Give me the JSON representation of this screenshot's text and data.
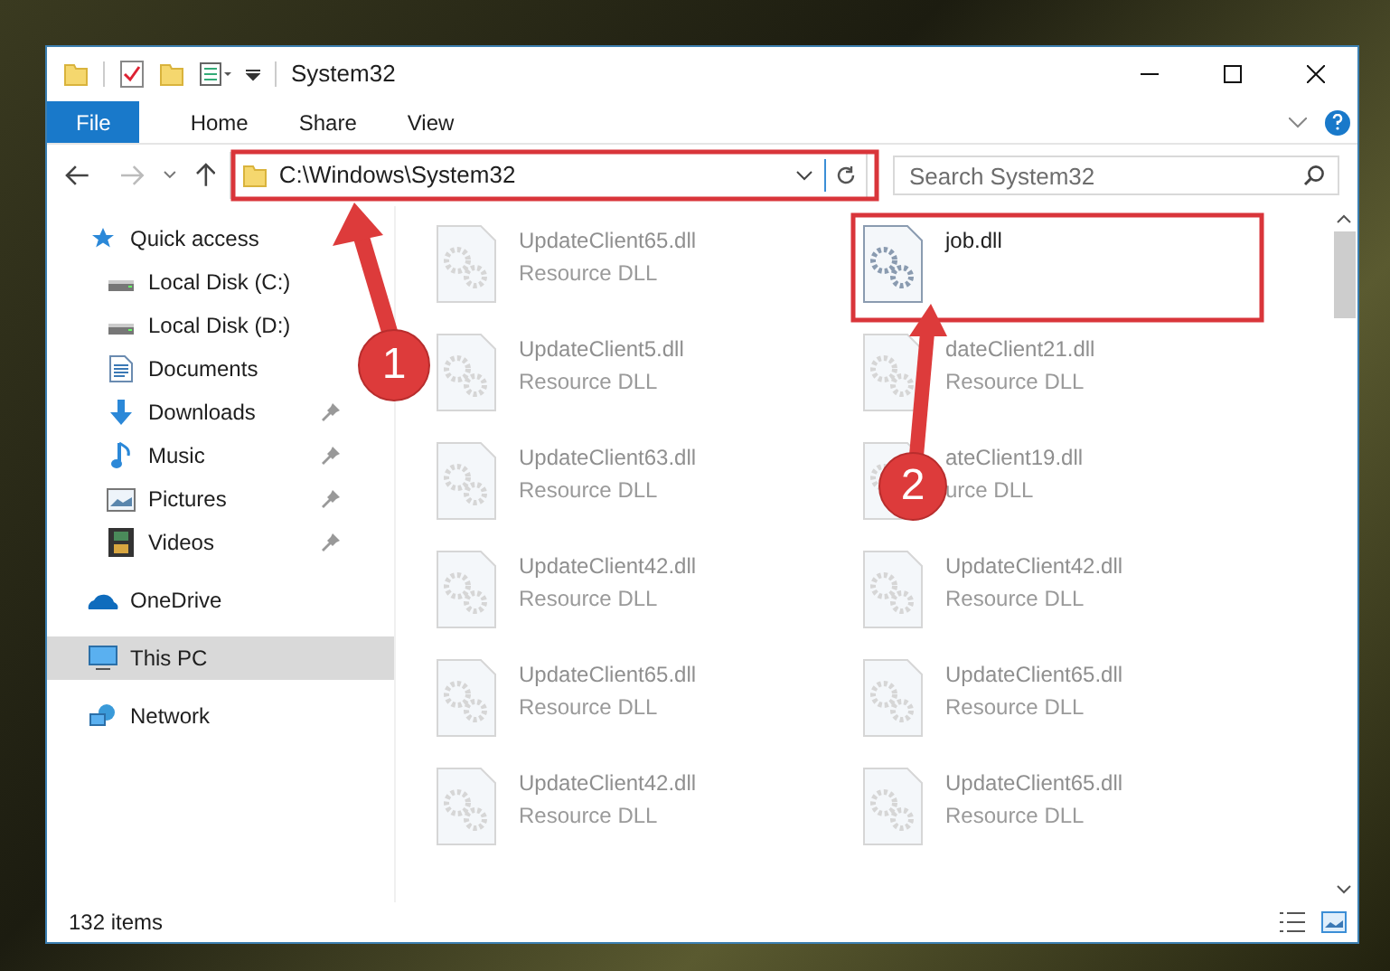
{
  "window": {
    "title": "System32"
  },
  "ribbon_tabs": [
    {
      "label": "File",
      "selected": true
    },
    {
      "label": "Home",
      "selected": false
    },
    {
      "label": "Share",
      "selected": false
    },
    {
      "label": "View",
      "selected": false
    }
  ],
  "address": {
    "value": "C:\\Windows\\System32"
  },
  "search": {
    "placeholder": "Search System32"
  },
  "sidebar": {
    "items": [
      {
        "label": "Quick access",
        "kind": "star",
        "pinned": false,
        "selected": false,
        "children": [
          {
            "label": "Local Disk (C:)",
            "kind": "drive",
            "pinned": false,
            "selected": false
          },
          {
            "label": "Local Disk (D:)",
            "kind": "drive",
            "pinned": false,
            "selected": false
          },
          {
            "label": "Documents",
            "kind": "document",
            "pinned": false,
            "selected": false
          },
          {
            "label": "Downloads",
            "kind": "download",
            "pinned": true,
            "selected": false
          },
          {
            "label": "Music",
            "kind": "music",
            "pinned": true,
            "selected": false
          },
          {
            "label": "Pictures",
            "kind": "picture",
            "pinned": true,
            "selected": false
          },
          {
            "label": "Videos",
            "kind": "video",
            "pinned": true,
            "selected": false
          }
        ]
      },
      {
        "label": "OneDrive",
        "kind": "cloud",
        "pinned": false,
        "selected": false
      },
      {
        "label": "This PC",
        "kind": "pc",
        "pinned": false,
        "selected": true
      },
      {
        "label": "Network",
        "kind": "network",
        "pinned": false,
        "selected": false
      }
    ]
  },
  "files": [
    {
      "name": "UpdateClient65.dll",
      "type": "Resource DLL",
      "faded": true
    },
    {
      "name": "job.dll",
      "faded": false
    },
    {
      "name": "UpdateClient5.dll",
      "type": "Resource DLL",
      "faded": true
    },
    {
      "name": "dateClient21.dll",
      "type": "Resource DLL",
      "faded": true
    },
    {
      "name": "UpdateClient63.dll",
      "type": "Resource DLL",
      "faded": true
    },
    {
      "name": "ateClient19.dll",
      "type": "urce DLL",
      "faded": true
    },
    {
      "name": "UpdateClient42.dll",
      "type": "Resource DLL",
      "faded": true
    },
    {
      "name": "UpdateClient42.dll",
      "type": "Resource DLL",
      "faded": true
    },
    {
      "name": "UpdateClient65.dll",
      "type": "Resource DLL",
      "faded": true
    },
    {
      "name": "UpdateClient65.dll",
      "type": "Resource DLL",
      "faded": true
    },
    {
      "name": "UpdateClient42.dll",
      "type": "Resource DLL",
      "faded": true
    },
    {
      "name": "UpdateClient65.dll",
      "type": "Resource DLL",
      "faded": true
    }
  ],
  "status_bar": {
    "item_count": "132 items"
  },
  "annotations": [
    {
      "kind": "frame"
    },
    {
      "kind": "frame"
    },
    {
      "kind": "badge",
      "label": "1"
    },
    {
      "kind": "badge",
      "label": "2"
    }
  ]
}
